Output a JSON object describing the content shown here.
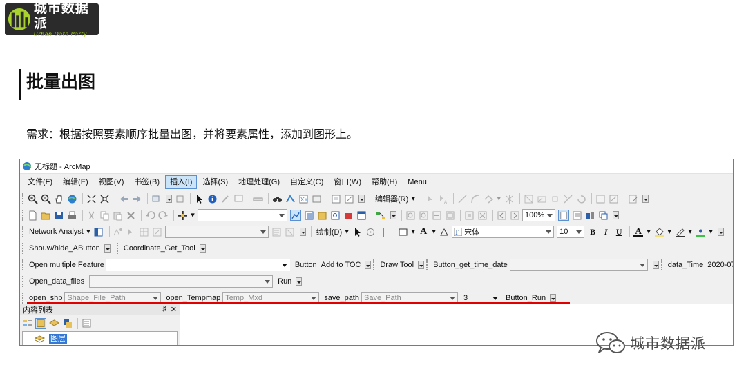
{
  "logo": {
    "name_cn": "城市数据派",
    "name_en": "Urban Data Party"
  },
  "slide": {
    "title": "批量出图",
    "requirement": "需求：根据按照要素顺序批量出图，并将要素属性，添加到图形上。"
  },
  "window": {
    "title": "无标题 - ArcMap"
  },
  "menu": [
    "文件(F)",
    "编辑(E)",
    "视图(V)",
    "书签(B)",
    "插入(I)",
    "选择(S)",
    "地理处理(G)",
    "自定义(C)",
    "窗口(W)",
    "帮助(H)",
    "Menu"
  ],
  "menu_active_index": 4,
  "toolbar1": {
    "editor_label": "编辑器(R)"
  },
  "toolbar2": {
    "scale_value": "",
    "zoom_value": "100%"
  },
  "toolbar3": {
    "network_analyst": "Network Analyst",
    "layer_combo": "",
    "draw_label": "绘制(D)",
    "font_value": "宋体",
    "font_size": "10",
    "bold": "B",
    "italic": "I",
    "underline": "U",
    "font_color_letter": "A"
  },
  "toolbar4": {
    "show_hide": "Shouw/hide_AButton",
    "coord_tool": "Coordinate_Get_Tool"
  },
  "toolbar5": {
    "open_multiple": "Open multiple Feature",
    "feature_value": "",
    "button_label": "Button",
    "add_to_toc": "Add to TOC",
    "draw_tool": "Draw Tool",
    "get_time": "Button_get_time_date",
    "time_combo_value": "",
    "data_time_label": "data_Time",
    "data_time_value": "2020-07"
  },
  "toolbar6": {
    "open_data_files": "Open_data_files",
    "files_value": "",
    "run": "Run"
  },
  "toolbar7": {
    "open_shp": "open_shp",
    "shp_placeholder": "Shape_File_Path",
    "open_tempmap": "open_Tempmap",
    "temp_placeholder": "Temp_Mxd",
    "save_path": "save_path",
    "save_placeholder": "Save_Path",
    "count_value": "3",
    "button_run": "Button_Run"
  },
  "toc": {
    "title": "内容列表",
    "pin": "♯",
    "close": "✕",
    "root_layer": "图层"
  },
  "watermark": {
    "text": "城市数据派"
  },
  "colors": {
    "accent_red": "#e00000",
    "logo_green": "#a9d32c",
    "menu_highlight": "#cce4f7",
    "selection_blue": "#3278d4"
  }
}
